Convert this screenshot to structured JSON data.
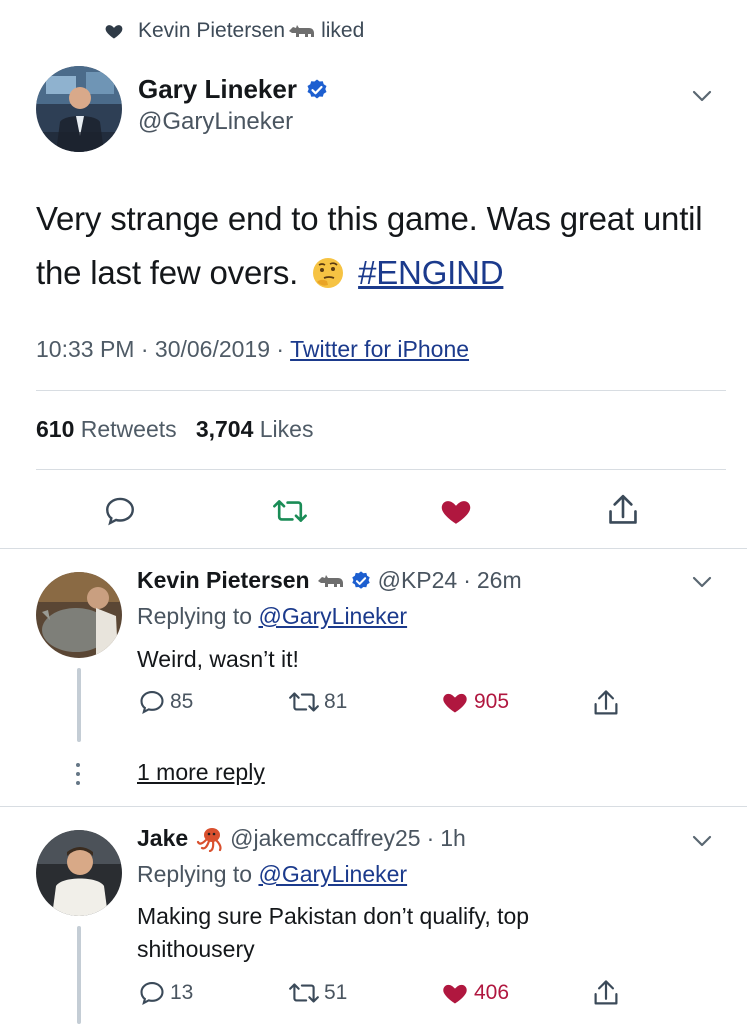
{
  "liked_header": {
    "user": "Kevin Pietersen",
    "emoji_icon": "rhino-icon",
    "text": "liked"
  },
  "main_tweet": {
    "name": "Gary Lineker",
    "handle": "@GaryLineker",
    "text_before": "Very strange end to this game. Was great until the last few overs.",
    "emoji_icon": "thinking-face-icon",
    "hashtag": "#ENGIND",
    "time": "10:33 PM",
    "date": "30/06/2019",
    "source": "Twitter for iPhone",
    "retweets_count": "610",
    "retweets_label": "Retweets",
    "likes_count": "3,704",
    "likes_label": "Likes"
  },
  "replies": [
    {
      "name": "Kevin Pietersen",
      "name_emoji_icon": "rhino-icon",
      "verified": true,
      "handle": "@KP24",
      "time": "26m",
      "replying_prefix": "Replying to",
      "replying_to": "@GaryLineker",
      "text": "Weird, wasn’t it!",
      "replies": "85",
      "retweets": "81",
      "likes": "905",
      "more_replies": "1 more reply"
    },
    {
      "name": "Jake",
      "name_emoji_icon": "octopus-icon",
      "verified": false,
      "handle": "@jakemccaffrey25",
      "time": "1h",
      "replying_prefix": "Replying to",
      "replying_to": "@GaryLineker",
      "text": "Making sure Pakistan don’t qualify, top shithousery",
      "replies": "13",
      "retweets": "51",
      "likes": "406"
    }
  ],
  "colors": {
    "like_red": "#b0173f",
    "link_blue": "#1b3a8c",
    "verified_blue": "#1d5fd0",
    "icon_gray": "#3b4a59"
  }
}
